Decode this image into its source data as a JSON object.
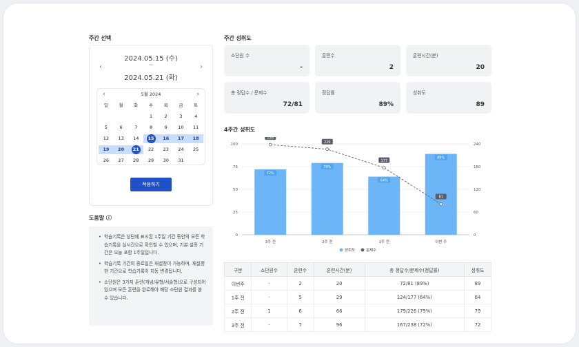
{
  "week_select": {
    "title": "주간 선택",
    "date_start": "2024.05.15 (수)",
    "tilde": "~",
    "date_end": "2024.05.21 (화)",
    "prev_icon": "‹",
    "next_icon": "›"
  },
  "calendar": {
    "month_label": "5월 2024",
    "weekdays": [
      "일",
      "월",
      "화",
      "수",
      "목",
      "금",
      "토"
    ],
    "weeks": [
      [
        "",
        "",
        "",
        "1",
        "2",
        "3",
        "4"
      ],
      [
        "5",
        "6",
        "7",
        "8",
        "9",
        "10",
        "11"
      ],
      [
        "12",
        "13",
        "14",
        "15",
        "16",
        "17",
        "18"
      ],
      [
        "19",
        "20",
        "21",
        "22",
        "23",
        "24",
        "25"
      ],
      [
        "26",
        "27",
        "28",
        "29",
        "30",
        "31",
        ""
      ]
    ],
    "range_start": "15",
    "range_end": "21",
    "range_color": "#c9defb",
    "selected_color": "#1f4fc2"
  },
  "apply_label": "적용하기",
  "help": {
    "title": "도움말 ⓘ",
    "items": [
      "학습기록은 상단에 표시된 1주일 기간 동안의 모든 학습기록을 실시간으로 확인할 수 있으며, 기본 설정 기간은 오늘 포함 1주일입니다.",
      "학습기록 기간의 종료일은 재설정이 가능하며, 재설정한 기간으로 학습기록이 지동 변경됩니다.",
      "소단원은 3가지 훈련(개념/유형/서술형)으로 구성되어 있으며 모든 훈련을 완료해야 해당 소단원 결과를 볼 수 있습니다."
    ]
  },
  "weekly": {
    "title": "주간 성취도",
    "stats": [
      {
        "label": "소단원 수",
        "value": "-"
      },
      {
        "label": "훈련수",
        "value": "2"
      },
      {
        "label": "훈련시간(분)",
        "value": "20"
      },
      {
        "label": "총 정답수 / 문제수",
        "value": "72/81"
      },
      {
        "label": "정답률",
        "value": "89%"
      },
      {
        "label": "성취도",
        "value": "89"
      }
    ]
  },
  "four_week": {
    "title": "4주간 성취도"
  },
  "chart_data": {
    "type": "bar",
    "categories": [
      "3주 전",
      "2주 전",
      "1주 전",
      "이번 주"
    ],
    "series": [
      {
        "name": "성취도",
        "type": "bar",
        "axis": "left",
        "values": [
          72,
          79,
          64,
          89
        ],
        "labels": [
          "72%",
          "79%",
          "64%",
          "89%"
        ],
        "color": "#6cb6f7"
      },
      {
        "name": "문제수",
        "type": "line",
        "axis": "right",
        "values": [
          238,
          226,
          177,
          81
        ],
        "labels": [
          "238",
          "226",
          "177",
          "81"
        ],
        "color": "#5a5f6b"
      }
    ],
    "left_ticks": [
      "0",
      "25",
      "50",
      "75",
      "100"
    ],
    "right_ticks": [
      "0",
      "60",
      "120",
      "180",
      "240"
    ],
    "ylim_left": [
      0,
      100
    ],
    "ylim_right": [
      0,
      240
    ],
    "legend_position": "bottom"
  },
  "table": {
    "headers": [
      "구분",
      "소단원수",
      "훈련수",
      "훈련시간(분)",
      "총 정답수/문제수(정답률)",
      "성취도"
    ],
    "rows": [
      [
        "이번주",
        "-",
        "2",
        "20",
        "72/81 (89%)",
        "89"
      ],
      [
        "1주 전",
        "-",
        "5",
        "29",
        "124/177 (64%)",
        "64"
      ],
      [
        "2주 전",
        "1",
        "6",
        "66",
        "179/226 (79%)",
        "79"
      ],
      [
        "3주 전",
        "-",
        "7",
        "96",
        "167/238 (72%)",
        "72"
      ]
    ]
  }
}
